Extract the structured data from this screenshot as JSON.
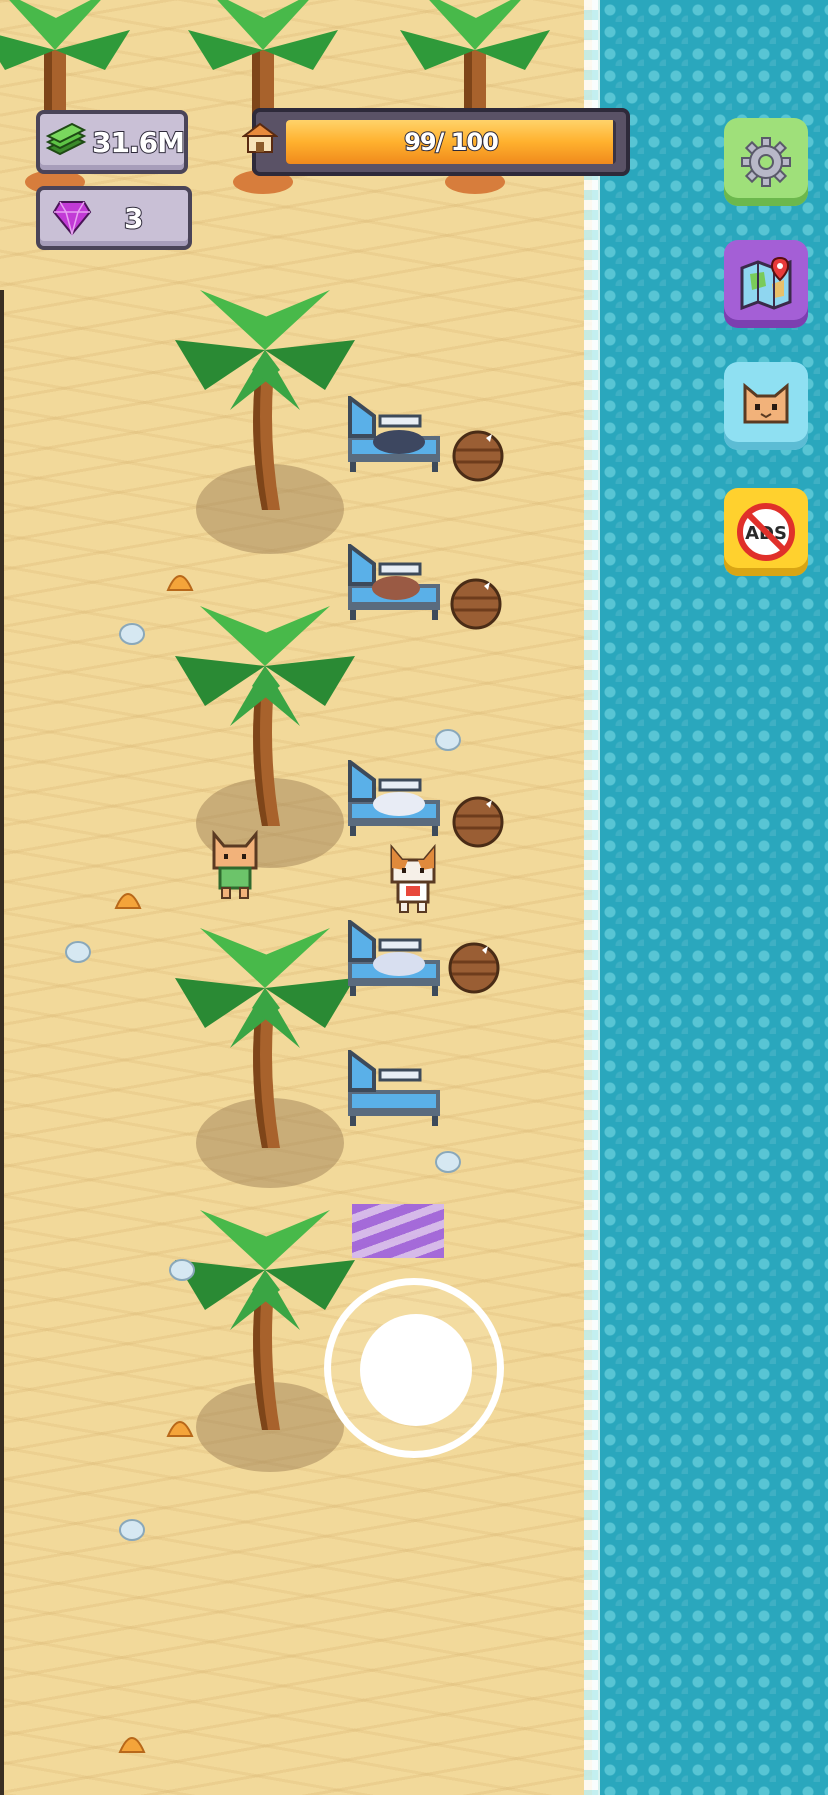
{
  "hud": {
    "money": "31.6M",
    "gems": "3",
    "capacity_text": "99/ 100",
    "capacity_fraction": 0.99
  },
  "icons": {
    "money": "cash-stack-icon",
    "gem": "purple-gem-icon",
    "capacity": "house-icon",
    "settings": "gear-icon",
    "map": "map-icon",
    "cat": "cat-face-icon",
    "noads": "no-ads-icon"
  },
  "side_buttons": [
    "settings",
    "map",
    "cats",
    "no-ads"
  ],
  "no_ads_label": "ADS",
  "colors": {
    "sand": "#f2d99a",
    "ocean": "#2aa7bd",
    "accent_gold": "#ffb12e",
    "gem_purple": "#c23ad6"
  }
}
